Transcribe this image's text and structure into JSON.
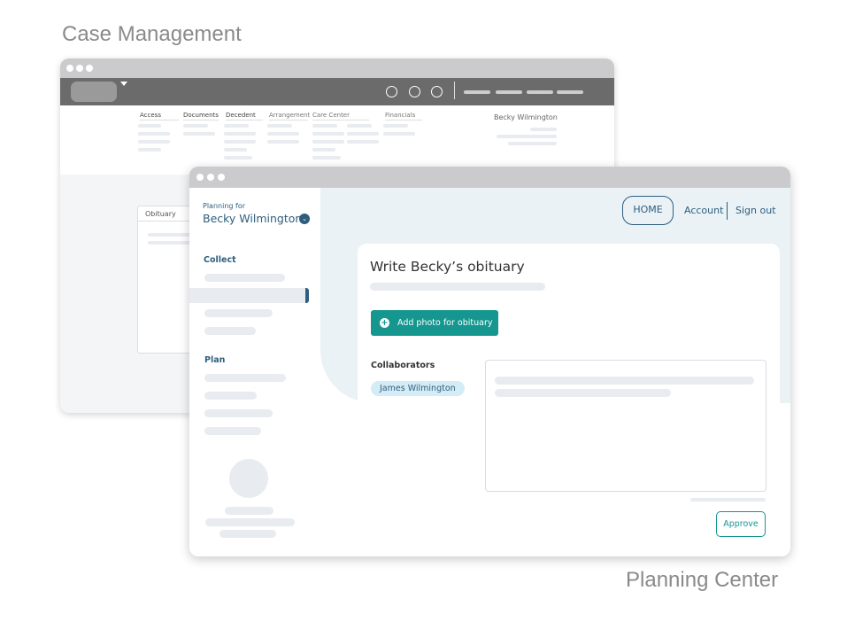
{
  "labels": {
    "case_management": "Case Management",
    "planning_center": "Planning Center"
  },
  "case_window": {
    "nav": [
      "Access",
      "Documents",
      "Decedent",
      "Arrangement",
      "Care Center",
      "Financials"
    ],
    "user": "Becky Wilmington",
    "card_title": "Obituary",
    "icons": [
      "search-icon",
      "bell-icon",
      "clock-icon"
    ]
  },
  "planning_window": {
    "planning_for": "Planning for",
    "person": "Becky Wilmington",
    "sections": {
      "collect": "Collect",
      "plan": "Plan"
    },
    "header": {
      "home": "HOME",
      "account": "Account",
      "sign_out": "Sign out"
    },
    "title": "Write Becky’s obituary",
    "add_photo": "Add photo for obituary",
    "collaborators_label": "Collaborators",
    "collaborator": "James Wilmington",
    "approve": "Approve"
  },
  "colors": {
    "accent": "#15968f",
    "navy": "#2e5e7e",
    "header_dark": "#6b6b6b",
    "panel": "#eaf2f6"
  }
}
